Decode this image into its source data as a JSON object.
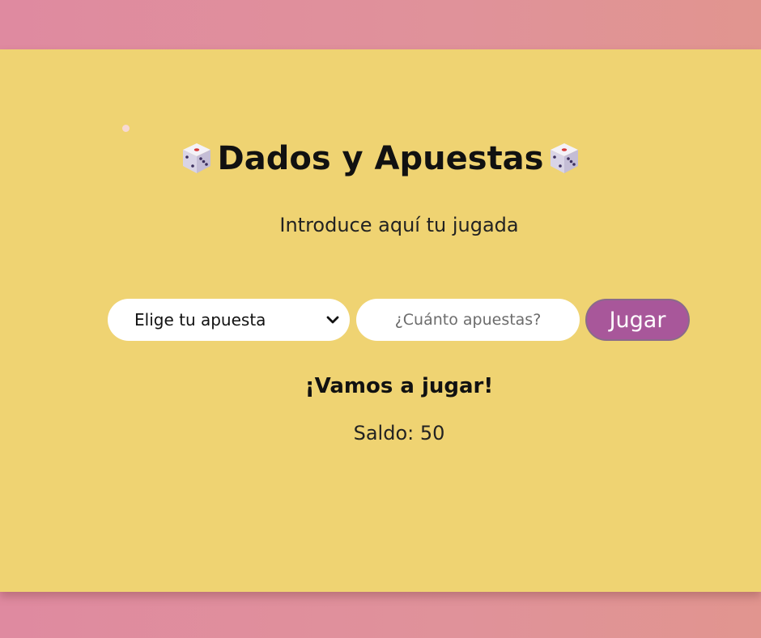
{
  "header": {
    "title": "Dados y Apuestas",
    "title_icon": "game-die-icon"
  },
  "subtitle": "Introduce aquí tu jugada",
  "form": {
    "bet_select_value": "Elige tu apuesta",
    "amount_placeholder": "¿Cuánto apuestas?",
    "play_label": "Jugar"
  },
  "status": {
    "message": "¡Vamos a jugar!",
    "balance_text": "Saldo: 50"
  },
  "colors": {
    "background": "#df8aa0",
    "panel": "#efd372",
    "button": "#a8579a"
  }
}
